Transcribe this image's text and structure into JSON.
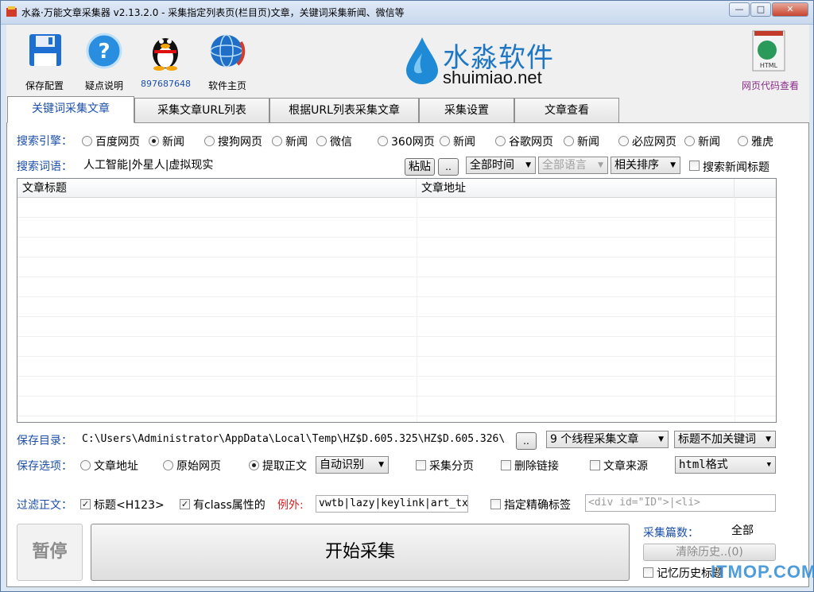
{
  "window": {
    "title": "水淼·万能文章采集器 v2.13.2.0 - 采集指定列表页(栏目页)文章，关键词采集新闻、微信等",
    "min_icon": "minimize-icon",
    "max_icon": "maximize-icon",
    "close_icon": "close-icon"
  },
  "toolbar": {
    "save_config": "保存配置",
    "help": "疑点说明",
    "qq": "897687648",
    "homepage": "软件主页",
    "html_view": "网页代码查看",
    "html_badge": "HTML"
  },
  "logo": {
    "cn": "水淼软件",
    "en": "shuimiao.net"
  },
  "tabs": [
    {
      "label": "关键词采集文章"
    },
    {
      "label": "采集文章URL列表"
    },
    {
      "label": "根据URL列表采集文章"
    },
    {
      "label": "采集设置"
    },
    {
      "label": "文章查看"
    }
  ],
  "engine": {
    "label": "搜索引擎：",
    "options": [
      "百度网页",
      "新闻",
      "搜狗网页",
      "新闻",
      "微信",
      "360网页",
      "新闻",
      "谷歌网页",
      "新闻",
      "必应网页",
      "新闻",
      "雅虎"
    ],
    "selected_index": 1
  },
  "keywords": {
    "label": "搜索词语：",
    "value": "人工智能|外星人|虚拟现实",
    "paste": "粘贴",
    "more": "..",
    "time": "全部时间",
    "lang": "全部语言",
    "sort": "相关排序",
    "news_title": "搜索新闻标题"
  },
  "grid": {
    "columns": [
      "文章标题",
      "文章地址"
    ]
  },
  "save_dir": {
    "label": "保存目录：",
    "value": "C:\\Users\\Administrator\\AppData\\Local\\Temp\\HZ$D.605.325\\HZ$D.605.326\\",
    "more": "..",
    "threads": "9 个线程采集文章",
    "title_opt": "标题不加关键词"
  },
  "save_opts": {
    "label": "保存选项：",
    "url": "文章地址",
    "raw": "原始网页",
    "extract": "提取正文",
    "auto": "自动识别",
    "paging": "采集分页",
    "del_links": "删除链接",
    "source": "文章来源",
    "format": "html格式"
  },
  "filter": {
    "label": "过滤正文：",
    "title_tag": "标题<H123>",
    "class_attr": "有class属性的",
    "example": "例外:",
    "class_value": "vwtb|lazy|keylink|art_tx",
    "precise": "指定精确标签",
    "precise_placeholder": "<div id=\"ID\">|<li>"
  },
  "actions": {
    "pause": "暂停",
    "start": "开始采集",
    "count_label": "采集篇数：",
    "count_value": "全部",
    "clear_history": "清除历史..(0)",
    "remember": "记忆历史标题"
  },
  "watermark": "ITMOP.COM",
  "colors": {
    "label_blue": "#1c4fa8",
    "example_red": "#e02020",
    "logo_blue": "#1f77c4"
  }
}
